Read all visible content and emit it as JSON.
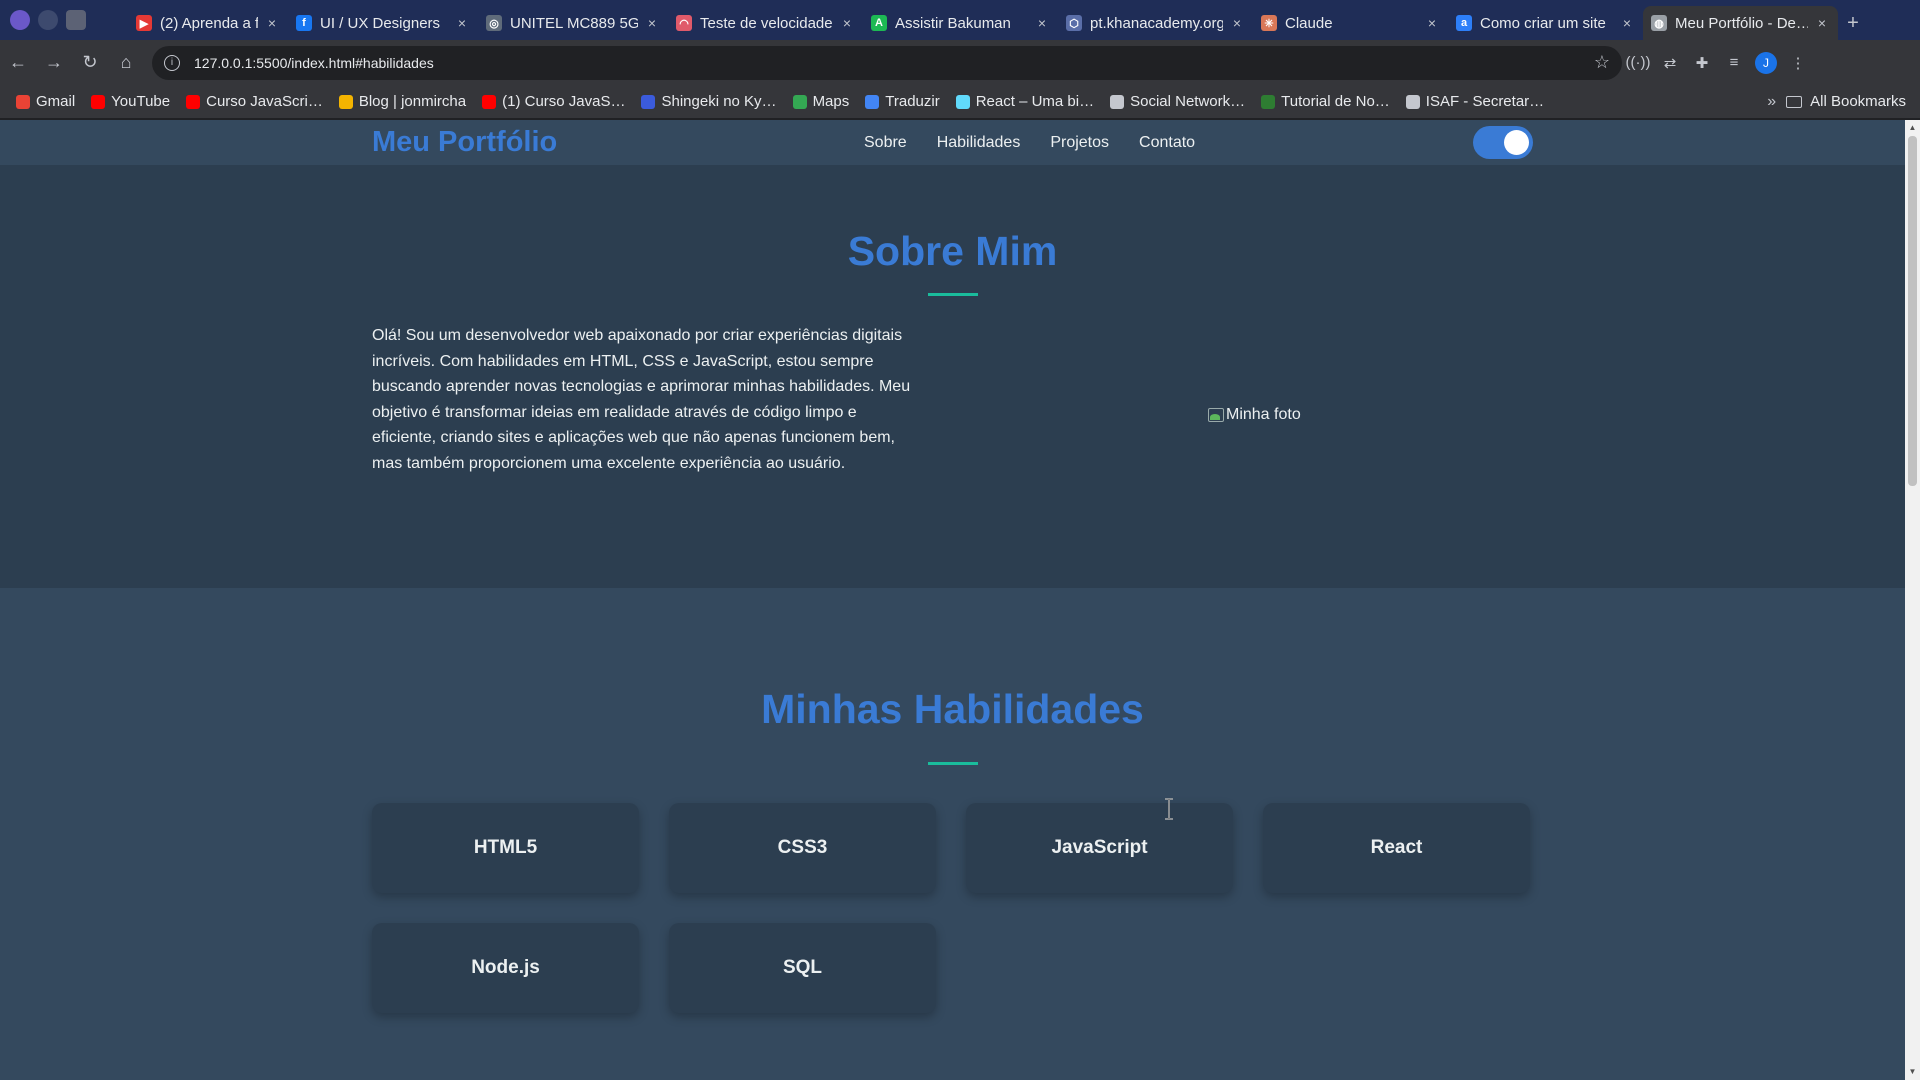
{
  "browser": {
    "tabs": [
      {
        "title": "(2) Aprenda a f…",
        "favicon_color": "#e53935",
        "favicon_text": "▶"
      },
      {
        "title": "UI / UX Designers",
        "favicon_color": "#1877f2",
        "favicon_text": "f"
      },
      {
        "title": "UNITEL MC889 5G",
        "favicon_color": "#5f6b7a",
        "favicon_text": "◎"
      },
      {
        "title": "Teste de velocidade",
        "favicon_color": "#e05a6a",
        "favicon_text": "◠"
      },
      {
        "title": "Assistir Bakuman",
        "favicon_color": "#1db954",
        "favicon_text": "A"
      },
      {
        "title": "pt.khanacademy.org",
        "favicon_color": "#5a6ea8",
        "favicon_text": "⬡"
      },
      {
        "title": "Claude",
        "favicon_color": "#d97757",
        "favicon_text": "✳"
      },
      {
        "title": "Como criar um site",
        "favicon_color": "#2d7ff9",
        "favicon_text": "a"
      },
      {
        "title": "Meu Portfólio - De…",
        "favicon_color": "#9aa0a6",
        "favicon_text": "◍",
        "active": true
      }
    ],
    "tab_close_glyph": "×",
    "new_tab_glyph": "+",
    "url": "127.0.0.1:5500/index.html#habilidades",
    "profile_initial": "J",
    "bookmarks": [
      {
        "label": "Gmail",
        "color": "#ea4335"
      },
      {
        "label": "YouTube",
        "color": "#ff0000"
      },
      {
        "label": "Curso JavaScri…",
        "color": "#ff0000"
      },
      {
        "label": "Blog | jonmircha",
        "color": "#f4b400"
      },
      {
        "label": "(1) Curso JavaS…",
        "color": "#ff0000"
      },
      {
        "label": "Shingeki no Ky…",
        "color": "#3b5bdb"
      },
      {
        "label": "Maps",
        "color": "#34a853"
      },
      {
        "label": "Traduzir",
        "color": "#4285f4"
      },
      {
        "label": "React – Uma bi…",
        "color": "#61dafb"
      },
      {
        "label": "Social Network…",
        "color": "#c4c7ce"
      },
      {
        "label": "Tutorial de No…",
        "color": "#2e7d32"
      },
      {
        "label": "ISAF - Secretar…",
        "color": "#c4c7ce"
      }
    ],
    "bookmarks_more": "»",
    "all_bookmarks": "All Bookmarks"
  },
  "site": {
    "logo": "Meu Portfólio",
    "nav": [
      "Sobre",
      "Habilidades",
      "Projetos",
      "Contato"
    ],
    "theme_toggle_on": true,
    "about": {
      "title": "Sobre Mim",
      "text": "Olá! Sou um desenvolvedor web apaixonado por criar experiências digitais incríveis. Com habilidades em HTML, CSS e JavaScript, estou sempre buscando aprender novas tecnologias e aprimorar minhas habilidades. Meu objetivo é transformar ideias em realidade através de código limpo e eficiente, criando sites e aplicações web que não apenas funcionem bem, mas também proporcionem uma excelente experiência ao usuário.",
      "photo_alt": "Minha foto"
    },
    "skills": {
      "title": "Minhas Habilidades",
      "items": [
        "HTML5",
        "CSS3",
        "JavaScript",
        "React",
        "Node.js",
        "SQL"
      ]
    }
  },
  "colors": {
    "accent": "#3a7bd5",
    "underline": "#1abc9c",
    "bg_dark": "#2c3e50",
    "bg_mid": "#34495e"
  }
}
